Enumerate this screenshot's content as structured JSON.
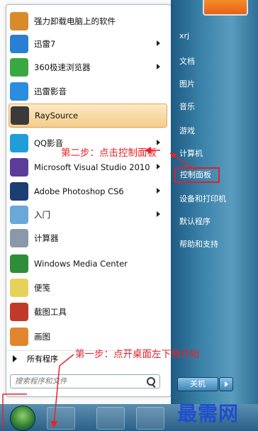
{
  "start_menu": {
    "programs": [
      {
        "label": "强力卸载电脑上的软件",
        "icon": "uninstall-box-icon",
        "color": "#d98a2b",
        "arrow": false
      },
      {
        "label": "迅雷7",
        "icon": "thunder-bird-icon",
        "color": "#2a7fd4",
        "arrow": true
      },
      {
        "label": "360极速浏览器",
        "icon": "browser-360-icon",
        "color": "#3aa840",
        "arrow": true
      },
      {
        "label": "迅雷影音",
        "icon": "thunder-player-icon",
        "color": "#2b8de0",
        "arrow": false
      },
      {
        "label": "RaySource",
        "icon": "raysource-icon",
        "color": "#3a3a3a",
        "arrow": false
      },
      {
        "label": "QQ影音",
        "icon": "qq-player-icon",
        "color": "#1f9ed8",
        "arrow": true
      },
      {
        "label": "Microsoft Visual Studio 2010",
        "icon": "visual-studio-icon",
        "color": "#5b3c99",
        "arrow": true
      },
      {
        "label": "Adobe Photoshop CS6",
        "icon": "photoshop-icon",
        "color": "#1b3e73",
        "arrow": true
      },
      {
        "label": "入门",
        "icon": "getting-started-icon",
        "color": "#6aa8d8",
        "arrow": true
      },
      {
        "label": "计算器",
        "icon": "calculator-icon",
        "color": "#8a98a8",
        "arrow": false
      },
      {
        "label": "Windows Media Center",
        "icon": "media-center-icon",
        "color": "#2f8d3a",
        "arrow": false
      },
      {
        "label": "便笺",
        "icon": "sticky-notes-icon",
        "color": "#e6d25a",
        "arrow": false
      },
      {
        "label": "截图工具",
        "icon": "snipping-tool-icon",
        "color": "#c0392b",
        "arrow": false
      },
      {
        "label": "画图",
        "icon": "paint-icon",
        "color": "#e0862f",
        "arrow": false
      }
    ],
    "all_programs": "所有程序",
    "search_placeholder": "搜索程序和文件",
    "right_items": [
      "xrj",
      "文档",
      "图片",
      "音乐",
      "游戏",
      "计算机",
      "控制面板",
      "设备和打印机",
      "默认程序",
      "帮助和支持"
    ],
    "shutdown_label": "关机"
  },
  "annotations": {
    "step2": "第二步：点击控制面板",
    "step1": "第一步：点开桌面左下角开始"
  },
  "watermark": "最需网",
  "colors": {
    "accent_red": "#e8232a",
    "highlight_orange": "#f5cd8a",
    "right_pane_blue": "#3b82a9"
  }
}
